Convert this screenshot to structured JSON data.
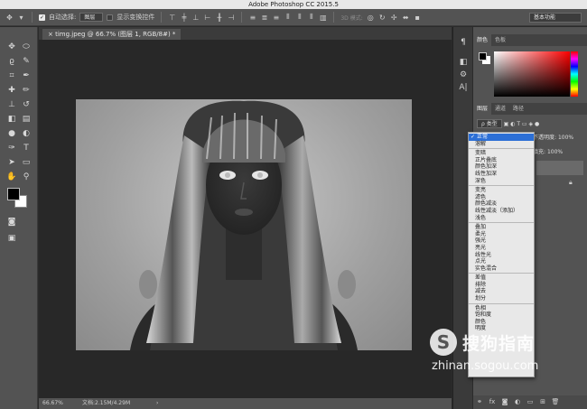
{
  "window": {
    "title": "Adobe Photoshop CC 2015.5"
  },
  "options_bar": {
    "auto_select_label": "自动选择:",
    "auto_select_value": "图层",
    "show_transform_label": "显示变换控件",
    "mode3d_label": "3D 模式:",
    "workspace": "基本功能"
  },
  "document": {
    "tab_title": "timg.jpeg @ 66.7% (图层 1, RGB/8#) *",
    "zoom": "66.67%",
    "doc_info": "文档:2.15M/4.29M"
  },
  "color_panel": {
    "tabs": [
      "颜色",
      "色板"
    ]
  },
  "layers_panel": {
    "tabs": [
      "图层",
      "通道",
      "路径"
    ],
    "filter_kind": "ρ 类型",
    "opacity_label": "不透明度:",
    "opacity_value": "100%",
    "fill_label": "填充:",
    "fill_value": "100%"
  },
  "blend_modes": {
    "selected": "正常",
    "groups": [
      [
        "正常",
        "溶解"
      ],
      [
        "变暗",
        "正片叠底",
        "颜色加深",
        "线性加深",
        "深色"
      ],
      [
        "变亮",
        "滤色",
        "颜色减淡",
        "线性减淡（添加）",
        "浅色"
      ],
      [
        "叠加",
        "柔光",
        "强光",
        "亮光",
        "线性光",
        "点光",
        "实色混合"
      ],
      [
        "差值",
        "排除",
        "减去",
        "划分"
      ],
      [
        "色相",
        "饱和度",
        "颜色",
        "明度"
      ]
    ]
  },
  "watermark": {
    "brand": "搜狗指南",
    "url": "zhinan.sogou.com",
    "logo": "S"
  },
  "colors": {
    "chrome": "#535353",
    "canvas": "#282828",
    "selection": "#2c6fd6"
  }
}
